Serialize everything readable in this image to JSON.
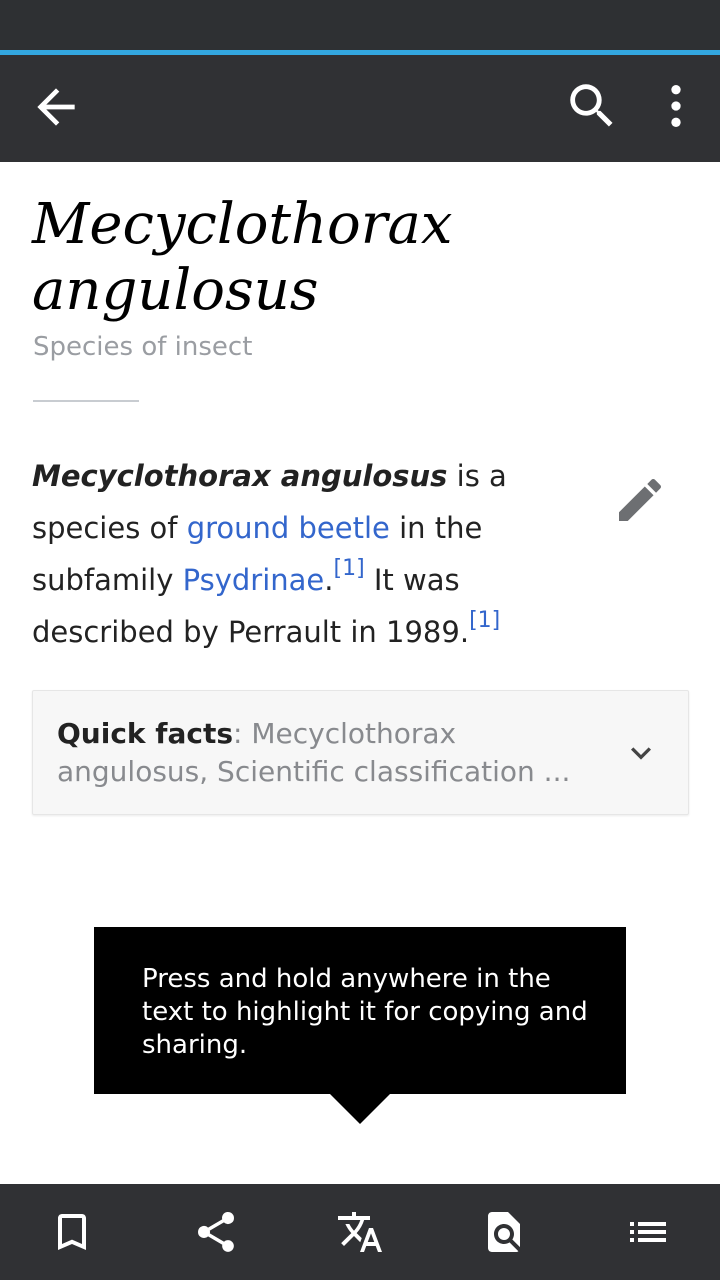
{
  "toolbar": {
    "back_icon": "arrow-back-icon",
    "search_icon": "search-icon",
    "more_icon": "more-vertical-icon"
  },
  "article": {
    "title": "Mecyclothorax angulosus",
    "description": "Species of insect",
    "lead": {
      "bold_name": "Mecyclothorax angulosus",
      "text1": " is a species of ",
      "link1": "ground beetle",
      "text2": " in the subfamily ",
      "link2": "Psydrinae",
      "text3": ".",
      "ref1": "[1]",
      "text4": " It was described by Perrault in 1989.",
      "ref2": "[1]"
    },
    "edit_icon": "pencil-icon"
  },
  "quick_facts": {
    "label": "Quick facts",
    "separator": ": ",
    "summary": "Mecyclothorax angulosus, Scientific classification ...",
    "expand_icon": "chevron-down-icon"
  },
  "tooltip": {
    "text": "Press and hold anywhere in the text to highlight it for copying and sharing."
  },
  "bottom_bar": {
    "items": [
      "bookmark-icon",
      "share-icon",
      "translate-icon",
      "find-in-page-icon",
      "contents-list-icon"
    ]
  },
  "colors": {
    "toolbar": "#303134",
    "accent": "#33a7e0",
    "link": "#3366cc",
    "tooltip": "#000000"
  }
}
